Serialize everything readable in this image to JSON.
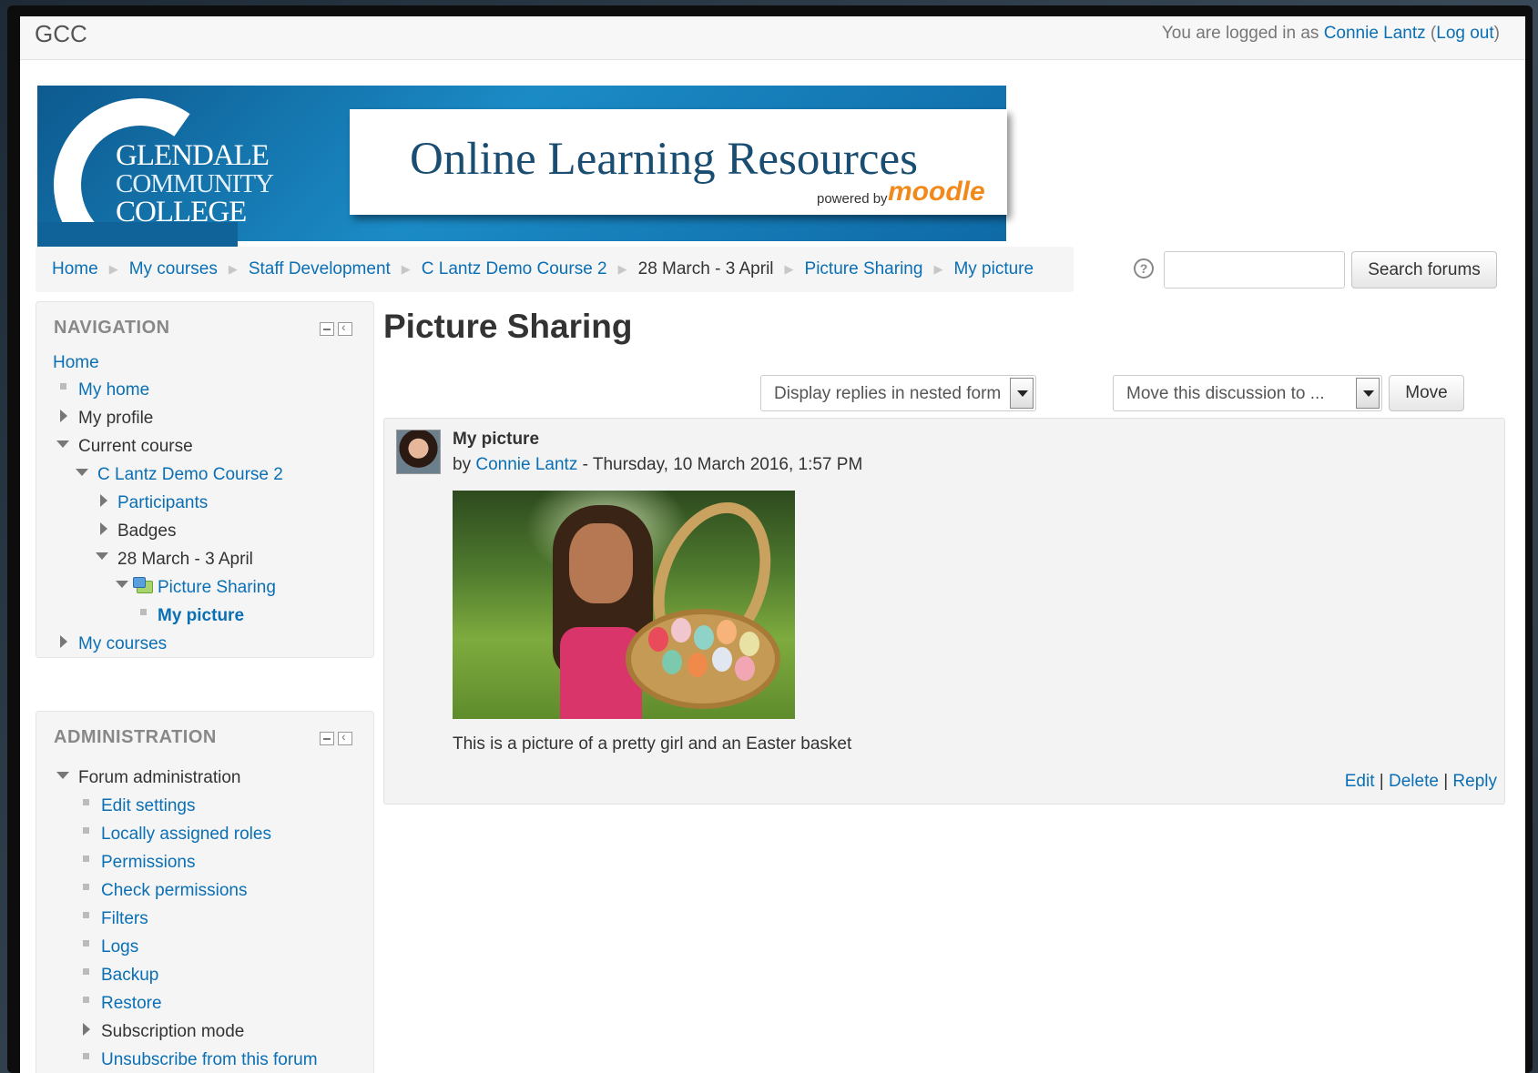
{
  "topbar": {
    "site_name": "GCC",
    "logged_prefix": "You are logged in as ",
    "user_name": "Connie Lantz",
    "logout_open": " (",
    "logout_label": "Log out",
    "logout_close": ")"
  },
  "banner": {
    "college_line1": "GLENDALE",
    "college_line2": "COMMUNITY",
    "college_line3": "COLLEGE",
    "title": "Online Learning Resources",
    "powered_by": "powered by",
    "moodle": "moodle"
  },
  "breadcrumb": {
    "separator": "▶",
    "items": [
      "Home",
      "My courses",
      "Staff Development",
      "C Lantz Demo Course 2",
      "28 March - 3 April",
      "Picture Sharing",
      "My picture"
    ]
  },
  "search": {
    "help": "?",
    "placeholder": "",
    "button_label": "Search forums"
  },
  "navigation": {
    "title": "NAVIGATION",
    "home": "Home",
    "my_home": "My home",
    "my_profile": "My profile",
    "current_course": "Current course",
    "course": "C Lantz Demo Course 2",
    "participants": "Participants",
    "badges": "Badges",
    "week": "28 March - 3 April",
    "forum": "Picture Sharing",
    "discussion": "My picture",
    "my_courses": "My courses"
  },
  "administration": {
    "title": "ADMINISTRATION",
    "forum_admin": "Forum administration",
    "items": [
      "Edit settings",
      "Locally assigned roles",
      "Permissions",
      "Check permissions",
      "Filters",
      "Logs",
      "Backup",
      "Restore"
    ],
    "subscription_mode": "Subscription mode",
    "unsubscribe": "Unsubscribe from this forum"
  },
  "main": {
    "title": "Picture Sharing",
    "display_select": "Display replies in nested form",
    "move_select": "Move this discussion to ...",
    "move_button": "Move"
  },
  "post": {
    "subject": "My picture",
    "by": "by ",
    "author": "Connie Lantz",
    "date": " - Thursday, 10 March 2016, 1:57 PM",
    "message": "This is a picture of a pretty girl and an Easter basket",
    "edit": "Edit",
    "sep": " | ",
    "delete": "Delete",
    "reply": "Reply"
  }
}
